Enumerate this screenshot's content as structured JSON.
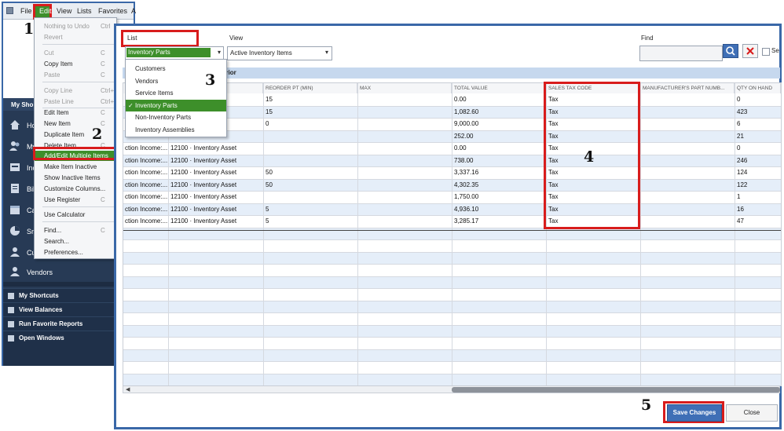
{
  "menubar": {
    "items": [
      "File",
      "Edit",
      "View",
      "Lists",
      "Favorites",
      "A"
    ]
  },
  "left_window": {
    "shortcuts_title": "My Shortcuts",
    "sidebar_items": [
      {
        "label": "Ho",
        "icon": "home-icon"
      },
      {
        "label": "My",
        "icon": "people-icon"
      },
      {
        "label": "Inc",
        "icon": "income-icon"
      },
      {
        "label": "Bil",
        "icon": "bills-icon"
      },
      {
        "label": "Ca",
        "icon": "calendar-icon"
      },
      {
        "label": "Sn",
        "icon": "snapshot-icon"
      },
      {
        "label": "Cu",
        "icon": "customer-icon"
      },
      {
        "label": "Vendors",
        "icon": "vendor-icon"
      }
    ],
    "bottom_items": [
      "My Shortcuts",
      "View Balances",
      "Run Favorite Reports",
      "Open Windows"
    ]
  },
  "edit_menu": {
    "items": [
      {
        "label": "Nothing to Undo",
        "shortcut": "Ctrl",
        "disabled": true
      },
      {
        "label": "Revert",
        "shortcut": "",
        "disabled": true
      },
      {
        "label": "Cut",
        "shortcut": "C",
        "disabled": true
      },
      {
        "label": "Copy Item",
        "shortcut": "C",
        "disabled": false
      },
      {
        "label": "Paste",
        "shortcut": "C",
        "disabled": true
      },
      {
        "label": "Copy Line",
        "shortcut": "Ctrl+",
        "disabled": true
      },
      {
        "label": "Paste Line",
        "shortcut": "Ctrl+",
        "disabled": true
      },
      {
        "label": "Edit Item",
        "shortcut": "C",
        "disabled": false
      },
      {
        "label": "New Item",
        "shortcut": "C",
        "disabled": false
      },
      {
        "label": "Duplicate Item",
        "shortcut": "",
        "disabled": false
      },
      {
        "label": "Delete Item",
        "shortcut": "C",
        "disabled": false
      },
      {
        "label": "Add/Edit Multiple Items",
        "shortcut": "",
        "disabled": false
      },
      {
        "label": "Make Item Inactive",
        "shortcut": "",
        "disabled": false
      },
      {
        "label": "Show Inactive Items",
        "shortcut": "",
        "disabled": false
      },
      {
        "label": "Customize Columns...",
        "shortcut": "",
        "disabled": false
      },
      {
        "label": "Use Register",
        "shortcut": "C",
        "disabled": false
      },
      {
        "label": "Use Calculator",
        "shortcut": "",
        "disabled": false
      },
      {
        "label": "Find...",
        "shortcut": "C",
        "disabled": false
      },
      {
        "label": "Search...",
        "shortcut": "",
        "disabled": false
      },
      {
        "label": "Preferences...",
        "shortcut": "",
        "disabled": false
      }
    ]
  },
  "steps": [
    "1",
    "2",
    "3",
    "4",
    "5"
  ],
  "dialog": {
    "list_label": "List",
    "list_value": "Inventory Parts",
    "view_label": "View",
    "view_value": "Active Inventory Items",
    "find_label": "Find",
    "find_value": "",
    "checkbox_label": "Se",
    "header_band_text": "erior",
    "list_options": [
      {
        "label": "Customers",
        "selected": false
      },
      {
        "label": "Vendors",
        "selected": false
      },
      {
        "label": "Service Items",
        "selected": false
      },
      {
        "label": "Inventory Parts",
        "selected": true
      },
      {
        "label": "Non-Inventory Parts",
        "selected": false
      },
      {
        "label": "Inventory Assemblies",
        "selected": false
      }
    ],
    "columns": [
      "",
      "",
      "REORDER PT (MIN)",
      "MAX",
      "TOTAL VALUE",
      "SALES TAX CODE",
      "MANUFACTURER'S PART NUMB...",
      "QTY ON HAND"
    ],
    "rows": [
      {
        "income": "",
        "asset": "set",
        "reorder": "15",
        "max": "",
        "total": "0.00",
        "tax": "Tax",
        "mpn": "",
        "qty": "0"
      },
      {
        "income": "",
        "asset": "set",
        "reorder": "15",
        "max": "",
        "total": "1,082.60",
        "tax": "Tax",
        "mpn": "",
        "qty": "423"
      },
      {
        "income": "",
        "asset": "set",
        "reorder": "0",
        "max": "",
        "total": "9,000.00",
        "tax": "Tax",
        "mpn": "",
        "qty": "6"
      },
      {
        "income": "",
        "asset": "",
        "reorder": "",
        "max": "",
        "total": "252.00",
        "tax": "Tax",
        "mpn": "",
        "qty": "21"
      },
      {
        "income": "ction Income:...",
        "asset": "12100 · Inventory Asset",
        "reorder": "",
        "max": "",
        "total": "0.00",
        "tax": "Tax",
        "mpn": "",
        "qty": "0"
      },
      {
        "income": "ction Income:...",
        "asset": "12100 · Inventory Asset",
        "reorder": "",
        "max": "",
        "total": "738.00",
        "tax": "Tax",
        "mpn": "",
        "qty": "246"
      },
      {
        "income": "ction Income:...",
        "asset": "12100 · Inventory Asset",
        "reorder": "50",
        "max": "",
        "total": "3,337.16",
        "tax": "Tax",
        "mpn": "",
        "qty": "124"
      },
      {
        "income": "ction Income:...",
        "asset": "12100 · Inventory Asset",
        "reorder": "50",
        "max": "",
        "total": "4,302.35",
        "tax": "Tax",
        "mpn": "",
        "qty": "122"
      },
      {
        "income": "ction Income:...",
        "asset": "12100 · Inventory Asset",
        "reorder": "",
        "max": "",
        "total": "1,750.00",
        "tax": "Tax",
        "mpn": "",
        "qty": "1"
      },
      {
        "income": "ction Income:...",
        "asset": "12100 · Inventory Asset",
        "reorder": "5",
        "max": "",
        "total": "4,936.10",
        "tax": "Tax",
        "mpn": "",
        "qty": "16"
      },
      {
        "income": "ction Income:...",
        "asset": "12100 · Inventory Asset",
        "reorder": "5",
        "max": "",
        "total": "3,285.17",
        "tax": "Tax",
        "mpn": "",
        "qty": "47"
      }
    ],
    "save_label": "Save Changes",
    "close_label": "Close"
  },
  "colors": {
    "accent_green": "#3d8f2a",
    "highlight_red": "#d81c1c",
    "button_blue": "#3f6fb6",
    "sidebar_navy": "#273a55"
  }
}
